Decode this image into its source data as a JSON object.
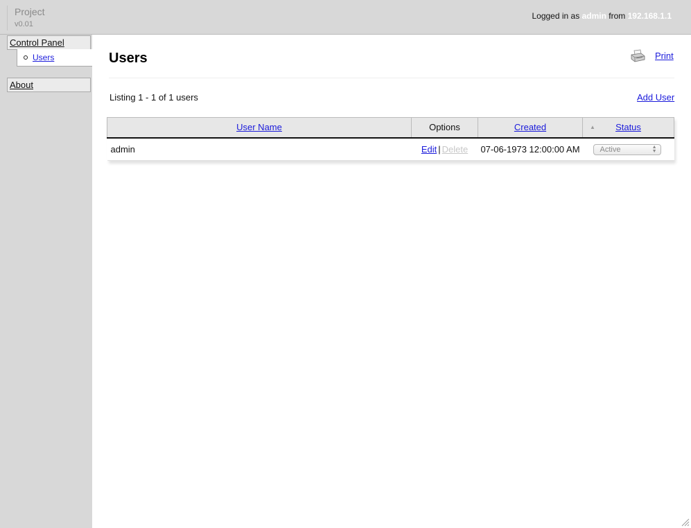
{
  "app": {
    "name": "Project",
    "version": "v0.01"
  },
  "login": {
    "prefix": "Logged in as",
    "user": "admin",
    "from_label": "from",
    "ip": "192.168.1.1"
  },
  "sidebar": {
    "control_panel": "Control Panel",
    "users": "Users",
    "about": "About"
  },
  "main": {
    "title": "Users",
    "print_label": "Print",
    "listing": "Listing 1 - 1 of 1 users",
    "add_user_label": "Add User"
  },
  "table": {
    "headers": {
      "user_name": "User Name",
      "options": "Options",
      "created": "Created",
      "status": "Status"
    },
    "rows": [
      {
        "user_name": "admin",
        "edit": "Edit",
        "separator": "|",
        "delete": "Delete",
        "created": "07-06-1973 12:00:00 AM",
        "status": "Active"
      }
    ]
  },
  "icons": {
    "print": "printer-icon",
    "sort": "sort-up-icon",
    "select": "select-arrows-icon",
    "resize": "resize-grip-icon"
  },
  "colors": {
    "link": "#1a1adb",
    "chrome": "#d8d8d8",
    "highlight": "#ffffff",
    "disabled": "#c7c7c7"
  }
}
